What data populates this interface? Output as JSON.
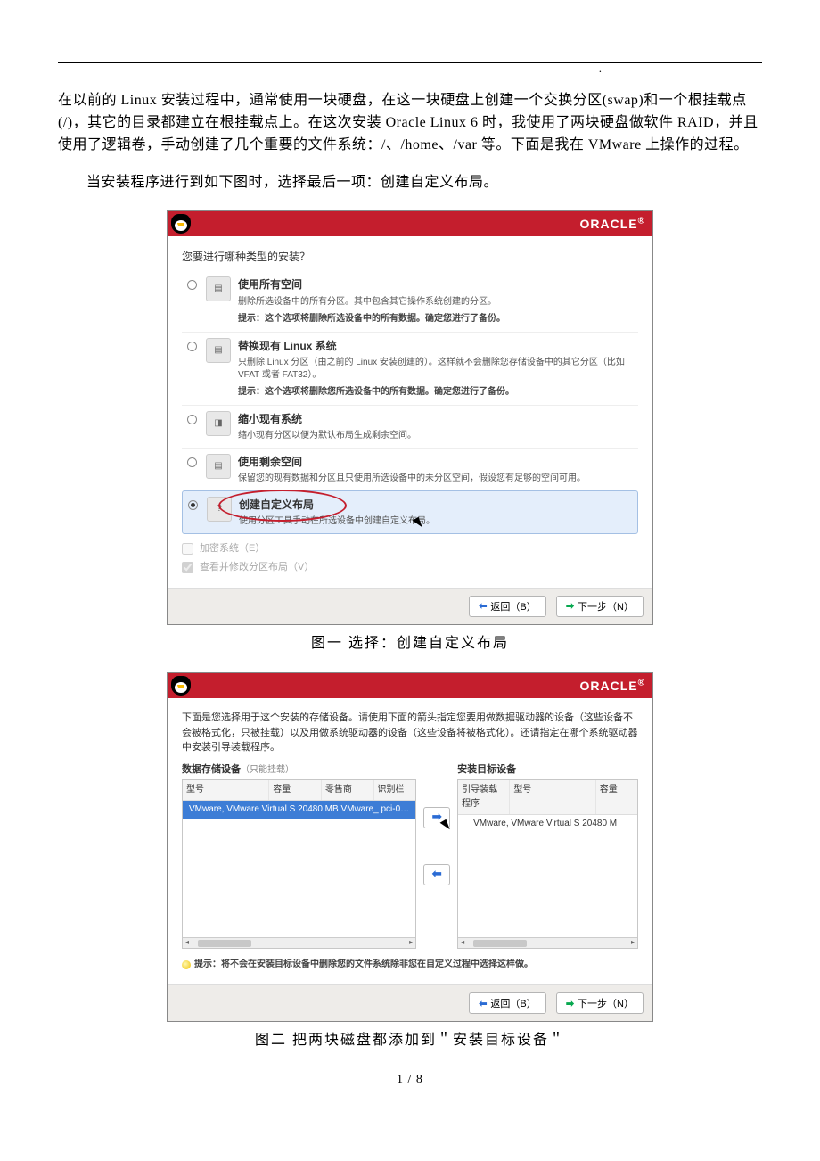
{
  "intro": {
    "p1": "在以前的 Linux 安装过程中，通常使用一块硬盘，在这一块硬盘上创建一个交换分区(swap)和一个根挂载点(/)，其它的目录都建立在根挂载点上。在这次安装 Oracle Linux 6 时，我使用了两块硬盘做软件 RAID，并且使用了逻辑卷，手动创建了几个重要的文件系统：/、/home、/var 等。下面是我在 VMware 上操作的过程。",
    "p2": "当安装程序进行到如下图时，选择最后一项：创建自定义布局。"
  },
  "brand": "ORACLE",
  "screen1": {
    "question": "您要进行哪种类型的安装？",
    "options": [
      {
        "title": "使用所有空间",
        "desc": "删除所选设备中的所有分区。其中包含其它操作系统创建的分区。",
        "hint": "提示：这个选项将删除所选设备中的所有数据。确定您进行了备份。"
      },
      {
        "title": "替换现有 Linux 系统",
        "desc": "只删除 Linux 分区（由之前的 Linux 安装创建的）。这样就不会删除您存储设备中的其它分区（比如 VFAT 或者 FAT32）。",
        "hint": "提示：这个选项将删除您所选设备中的所有数据。确定您进行了备份。"
      },
      {
        "title": "缩小现有系统",
        "desc": "缩小现有分区以便为默认布局生成剩余空间。"
      },
      {
        "title": "使用剩余空间",
        "desc": "保留您的现有数据和分区且只使用所选设备中的未分区空间，假设您有足够的空间可用。"
      },
      {
        "title": "创建自定义布局",
        "desc": "使用分区工具手动在所选设备中创建自定义布局。"
      }
    ],
    "encrypt": "加密系统（E）",
    "review": "查看并修改分区布局（V）"
  },
  "buttons": {
    "back": "返回（B）",
    "next": "下一步（N）"
  },
  "caption1": "图一   选择：创建自定义布局",
  "screen2": {
    "intro": "下面是您选择用于这个安装的存储设备。请使用下面的箭头指定您要用做数据驱动器的设备（这些设备不会被格式化，只被挂载）以及用做系统驱动器的设备（这些设备将被格式化）。还请指定在哪个系统驱动器中安装引导装载程序。",
    "left_title": "数据存储设备",
    "left_sub": "（只能挂载）",
    "right_title": "安装目标设备",
    "cols_left": {
      "model": "型号",
      "capacity": "容量",
      "vendor": "零售商",
      "id": "识别栏"
    },
    "cols_right": {
      "boot": "引导装载程序",
      "model": "型号",
      "capacity": "容量"
    },
    "row_l": "VMware, VMware Virtual S  20480 MB  VMware_  pci-0…",
    "row_r": "VMware, VMware Virtual S  20480 M",
    "tip": "提示：将不会在安装目标设备中删除您的文件系统除非您在自定义过程中选择这样做。"
  },
  "caption2": "图二   把两块磁盘都添加到＂安装目标设备＂",
  "page_num": "1 / 8"
}
